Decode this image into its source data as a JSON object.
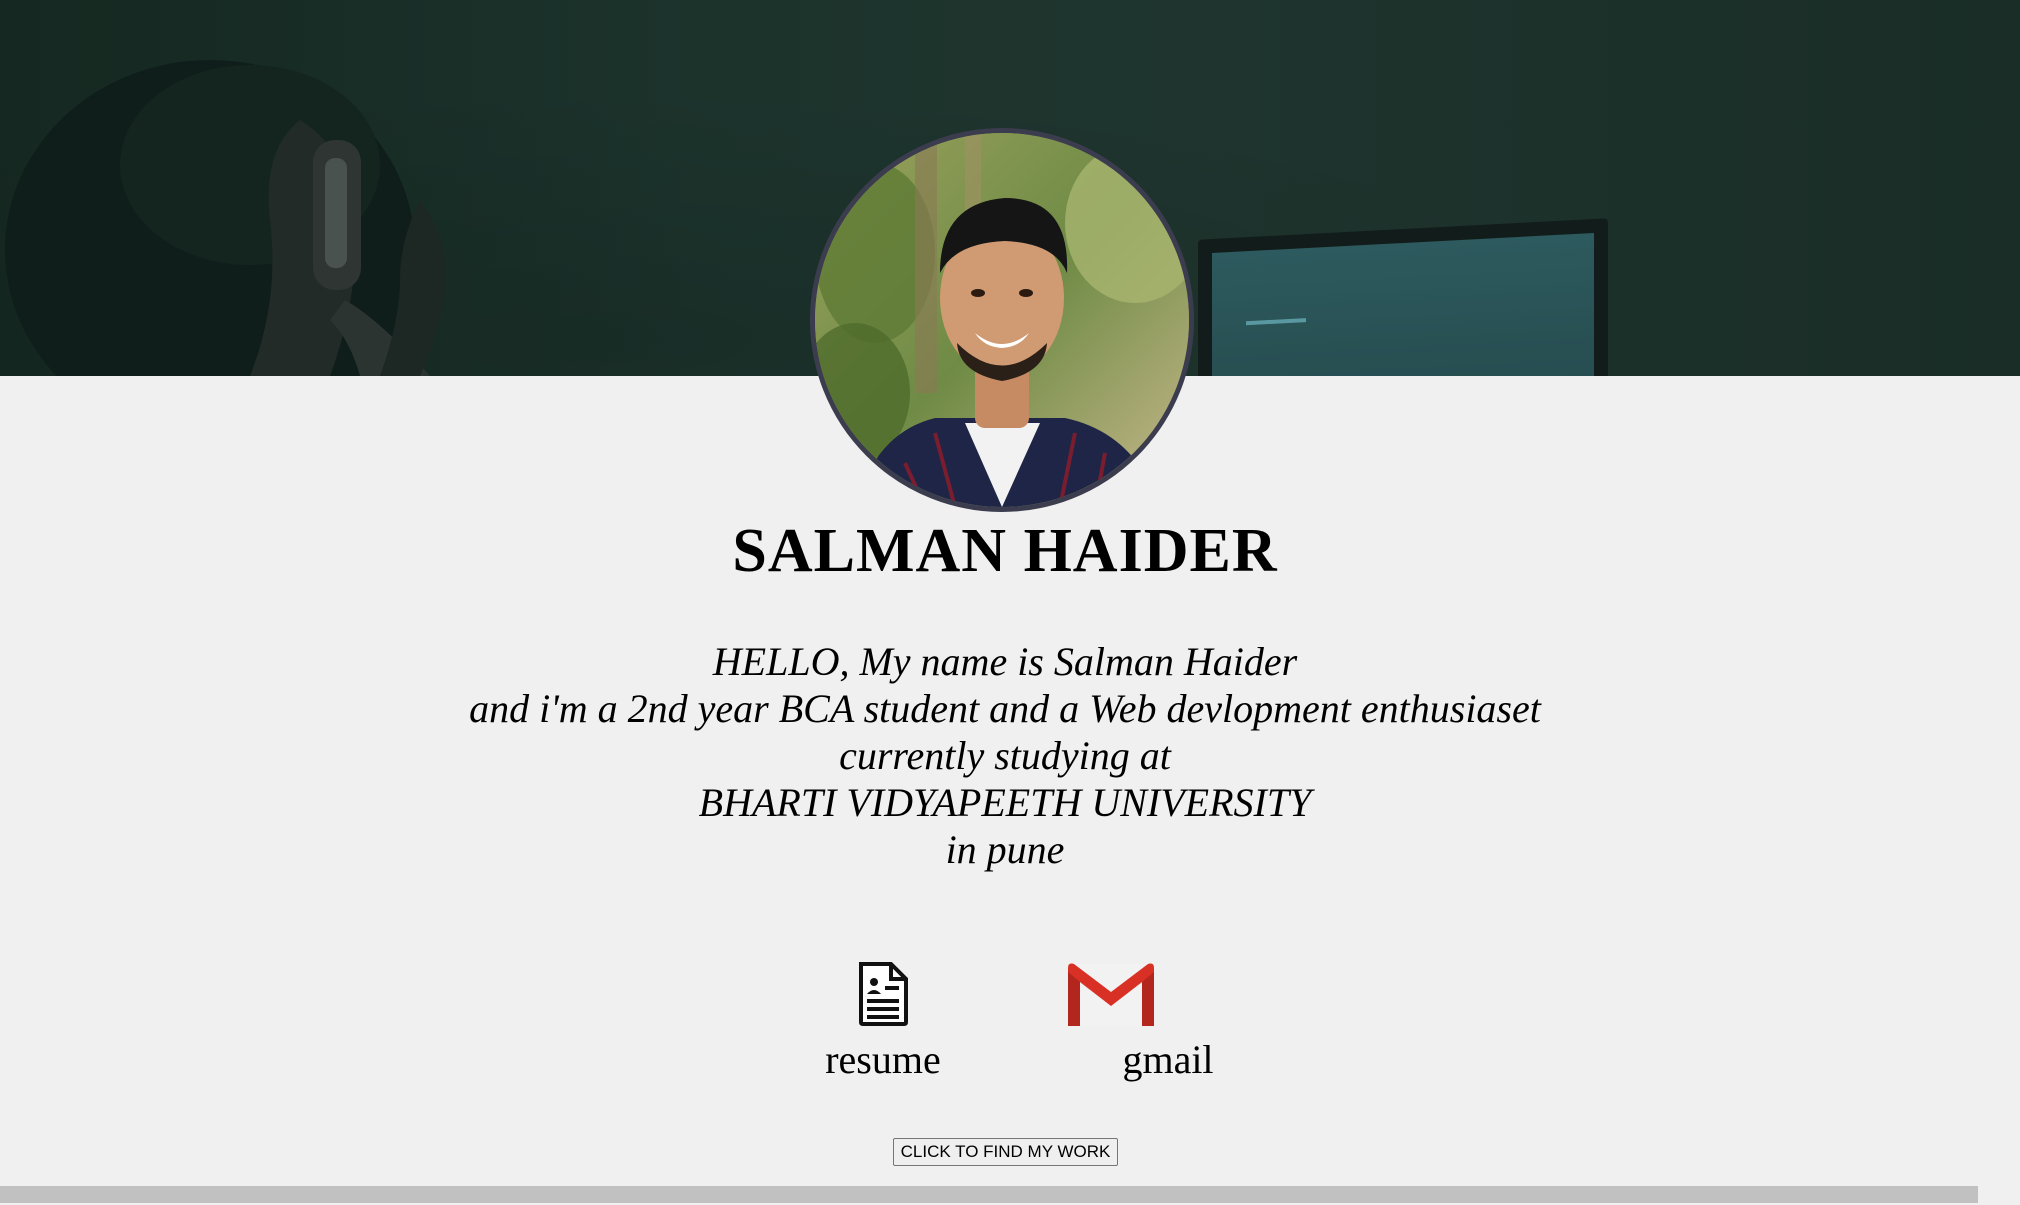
{
  "profile": {
    "name": "SALMAN HAIDER",
    "photo_icon": "profile-photo"
  },
  "intro": {
    "lines": [
      "HELLO, My name is Salman Haider",
      "and i'm a 2nd year BCA student and a Web devlopment enthusiaset",
      "currently studying at",
      "BHARTI VIDYAPEETH UNIVERSITY",
      "in pune"
    ]
  },
  "links": {
    "resume": {
      "label": "resume",
      "icon": "resume-icon"
    },
    "gmail": {
      "label": "gmail",
      "icon": "gmail-icon"
    }
  },
  "cta": {
    "label": "CLICK TO FIND MY WORK"
  },
  "colors": {
    "hero_bg": "#1c332c",
    "page_bg": "#f0f0f0",
    "avatar_border": "#3c3c4f",
    "gmail_red": "#d93025"
  }
}
